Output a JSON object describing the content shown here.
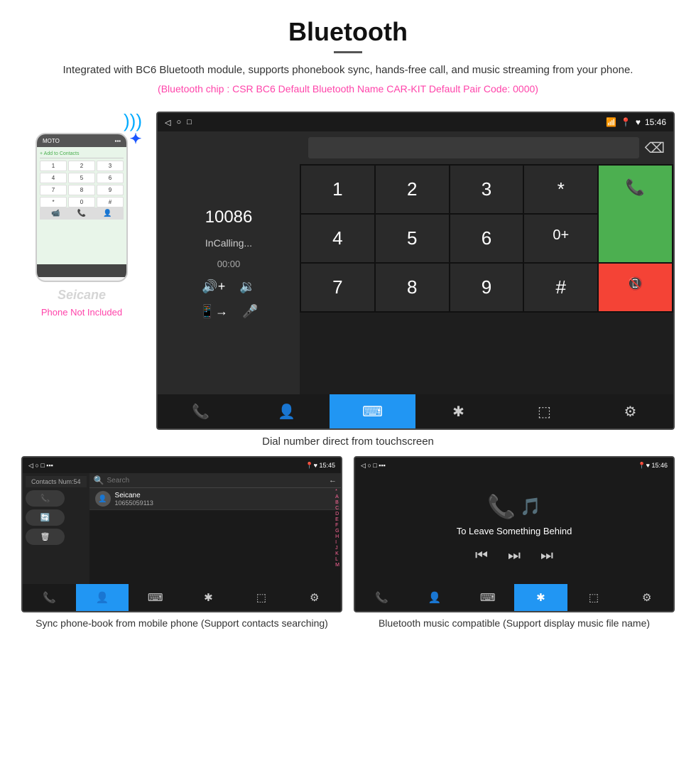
{
  "header": {
    "title": "Bluetooth",
    "description": "Integrated with BC6 Bluetooth module, supports phonebook sync, hands-free call, and music streaming from your phone.",
    "bt_info": "(Bluetooth chip : CSR BC6    Default Bluetooth Name CAR-KIT    Default Pair Code: 0000)"
  },
  "main_screen": {
    "status_bar": {
      "left": "◁  ○  □",
      "icons": "📱 🔒 ♥ 15:46"
    },
    "dial_number": "10086",
    "calling_text": "InCalling...",
    "calling_timer": "00:00",
    "keypad": [
      "1",
      "2",
      "3",
      "*",
      "4",
      "5",
      "6",
      "0+",
      "7",
      "8",
      "9",
      "#"
    ],
    "call_btn": "📞",
    "end_btn": "📞"
  },
  "main_caption": "Dial number direct from touchscreen",
  "phonebook_screen": {
    "contacts_count": "Contacts Num:54",
    "contact_name": "Seicane",
    "contact_number": "10655059113",
    "search_placeholder": "Search",
    "alpha_list": [
      "*",
      "A",
      "B",
      "C",
      "D",
      "E",
      "F",
      "G",
      "H",
      "I",
      "J",
      "K",
      "L",
      "M"
    ],
    "time": "15:45"
  },
  "phonebook_caption": "Sync phone-book from mobile phone\n(Support contacts searching)",
  "music_screen": {
    "song_title": "To Leave Something Behind",
    "time": "15:46"
  },
  "music_caption": "Bluetooth music compatible\n(Support display music file name)",
  "phone_not_included": "Phone Not Included",
  "seicane_watermark": "Seicane",
  "bottom_tabs": {
    "phone": "📞",
    "contacts": "👤",
    "keypad": "⌨",
    "bluetooth": "✱",
    "settings1": "⬚",
    "settings2": "⚙"
  }
}
